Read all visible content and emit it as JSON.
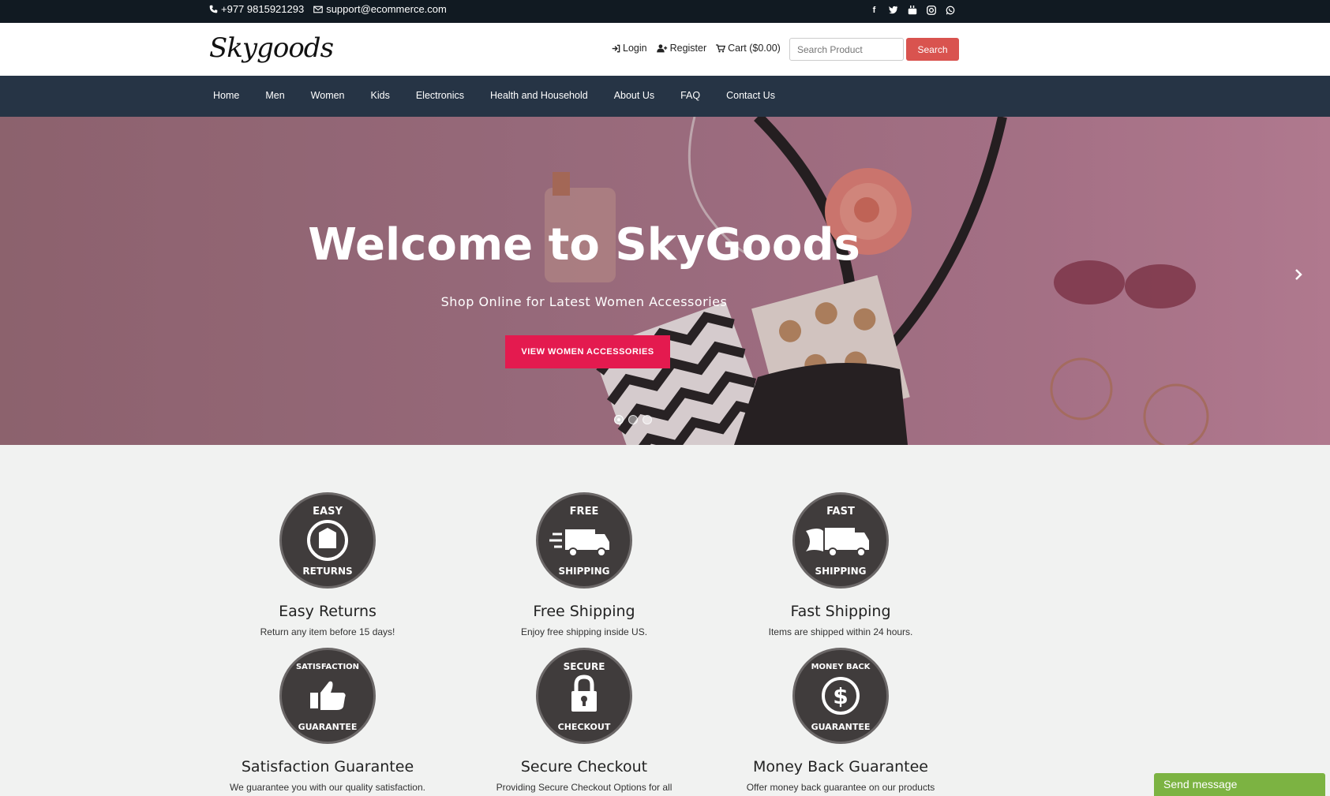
{
  "topbar": {
    "phone": "+977 9815921293",
    "email": "support@ecommerce.com",
    "social_icons": [
      "facebook-icon",
      "twitter-icon",
      "youtube-icon",
      "instagram-icon",
      "whatsapp-icon"
    ]
  },
  "header": {
    "logo": "Skygoods",
    "login": "Login",
    "register": "Register",
    "cart": "Cart ($0.00)",
    "search_placeholder": "Search Product",
    "search_button": "Search"
  },
  "nav": {
    "items": [
      "Home",
      "Men",
      "Women",
      "Kids",
      "Electronics",
      "Health and Household",
      "About Us",
      "FAQ",
      "Contact Us"
    ]
  },
  "hero": {
    "title": "Welcome to SkyGoods",
    "subtitle": "Shop Online for Latest Women Accessories",
    "button": "VIEW WOMEN ACCESSORIES",
    "slides": 3,
    "active_slide": 1
  },
  "features": [
    {
      "badge_top": "EASY",
      "badge_bottom": "RETURNS",
      "title": "Easy Returns",
      "text": "Return any item before 15 days!"
    },
    {
      "badge_top": "FREE",
      "badge_bottom": "SHIPPING",
      "title": "Free Shipping",
      "text": "Enjoy free shipping inside US."
    },
    {
      "badge_top": "FAST",
      "badge_bottom": "SHIPPING",
      "title": "Fast Shipping",
      "text": "Items are shipped within 24 hours."
    },
    {
      "badge_top": "SATISFACTION",
      "badge_bottom": "GUARANTEE",
      "title": "Satisfaction Guarantee",
      "text": "We guarantee you with our quality satisfaction."
    },
    {
      "badge_top": "SECURE",
      "badge_bottom": "CHECKOUT",
      "title": "Secure Checkout",
      "text": "Providing Secure Checkout Options for all"
    },
    {
      "badge_top": "MONEY BACK",
      "badge_bottom": "GUARANTEE",
      "title": "Money Back Guarantee",
      "text": "Offer money back guarantee on our products"
    }
  ],
  "chat": {
    "label": "Send message"
  },
  "colors": {
    "topbar": "#111a22",
    "nav": "#263445",
    "search_button": "#d9534f",
    "hero_button": "#e41a4f",
    "chat": "#7cb342",
    "badge": "#403c3c"
  }
}
